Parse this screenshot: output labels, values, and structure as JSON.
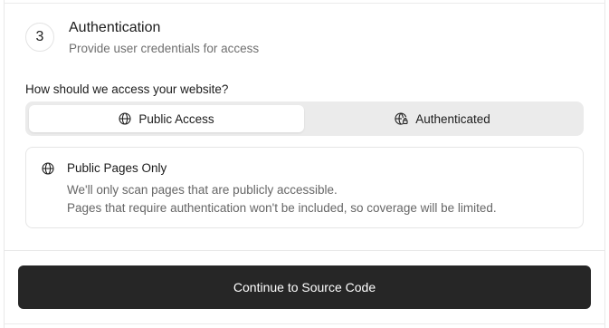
{
  "step": {
    "number": "3",
    "title": "Authentication",
    "subtitle": "Provide user credentials for access"
  },
  "access": {
    "question": "How should we access your website?",
    "options": [
      {
        "label": "Public Access",
        "icon": "globe-icon",
        "selected": true
      },
      {
        "label": "Authenticated",
        "icon": "globe-lock-icon",
        "selected": false
      }
    ]
  },
  "info": {
    "icon": "globe-icon",
    "title": "Public Pages Only",
    "line1": "We'll only scan pages that are publicly accessible.",
    "line2": "Pages that require authentication won't be included, so coverage will be limited."
  },
  "actions": {
    "continue_label": "Continue to Source Code"
  },
  "colors": {
    "primary_button": "#262626",
    "segment_bg": "#ebebeb",
    "muted_text": "#666666"
  }
}
